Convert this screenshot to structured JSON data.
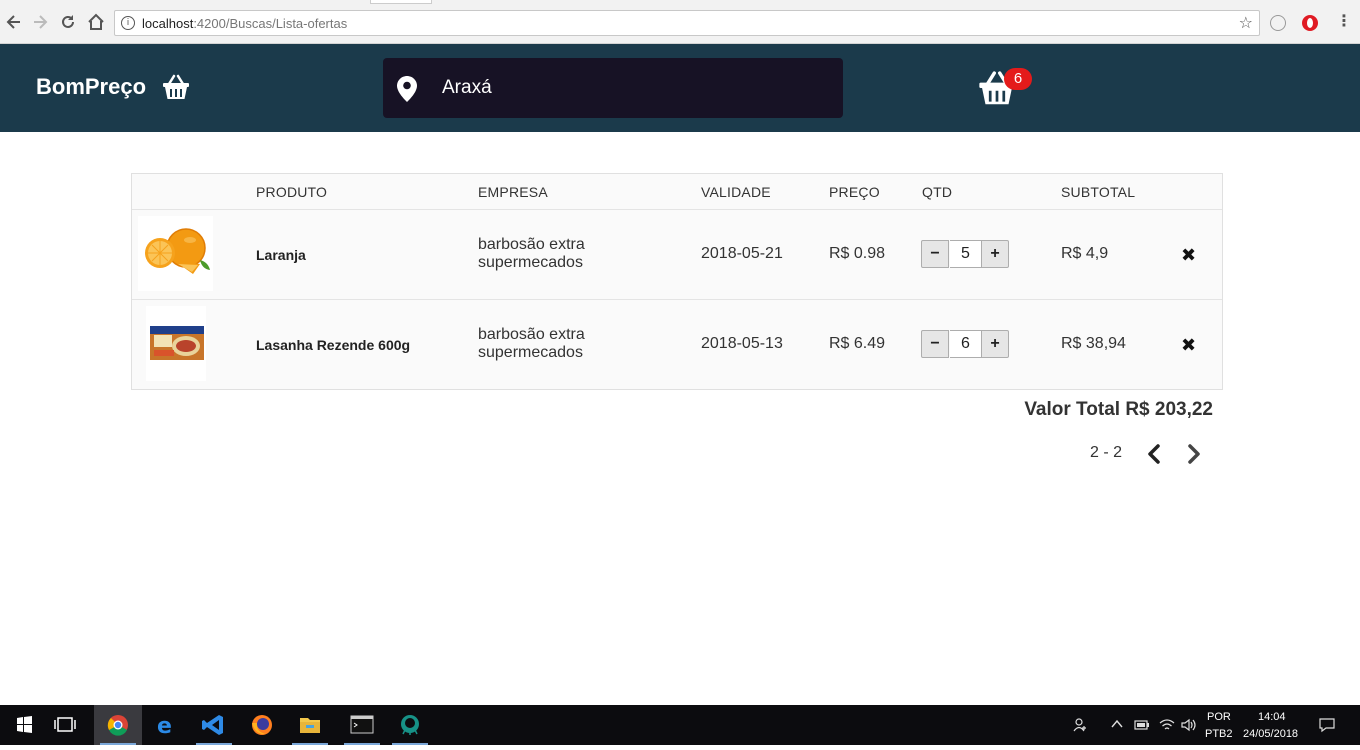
{
  "browser": {
    "url_host": "localhost",
    "url_path": ":4200/Buscas/Lista-ofertas",
    "icons": [
      "back-icon",
      "forward-icon",
      "reload-icon",
      "home-icon",
      "info-icon",
      "bookmark-star-icon",
      "extension-icon",
      "opera-icon",
      "menu-icon"
    ]
  },
  "header": {
    "brand": "BomPreço",
    "location": "Araxá",
    "cart_count": "6",
    "colors": {
      "header_bg": "#1b3a4b",
      "location_bg": "#171225",
      "badge": "#e41b1b"
    }
  },
  "table": {
    "columns": [
      "PRODUTO",
      "EMPRESA",
      "VALIDADE",
      "PREÇO",
      "QTD",
      "SUBTOTAL"
    ],
    "rows": [
      {
        "image": "orange-image",
        "name": "Laranja",
        "company_line1": "barbosão extra",
        "company_line2": "supermecados",
        "validity": "2018-05-21",
        "price": "R$ 0.98",
        "qty": "5",
        "subtotal": "R$ 4,9"
      },
      {
        "image": "lasagna-package-image",
        "name": "Lasanha Rezende 600g",
        "company_line1": "barbosão extra",
        "company_line2": "supermecados",
        "validity": "2018-05-13",
        "price": "R$ 6.49",
        "qty": "6",
        "subtotal": "R$ 38,94"
      }
    ],
    "minus_label": "−",
    "plus_label": "+",
    "remove_label": "✖"
  },
  "summary": {
    "total": "Valor Total R$ 203,22",
    "pager": "2 - 2"
  },
  "taskbar": {
    "apps": [
      "windows-start-icon",
      "task-view-icon",
      "chrome-icon",
      "edge-icon",
      "vscode-icon",
      "firefox-icon",
      "file-explorer-icon",
      "terminal-icon",
      "gitkraken-icon"
    ],
    "lang_top": "POR",
    "lang_bottom": "PTB2",
    "time": "14:04",
    "date": "24/05/2018"
  }
}
